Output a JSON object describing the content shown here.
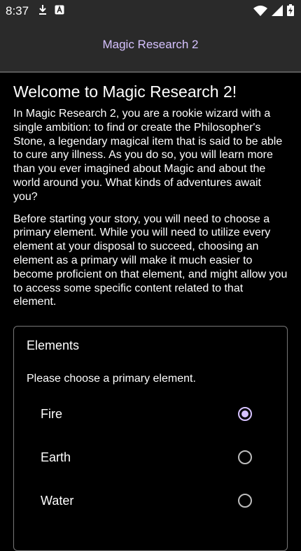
{
  "status_bar": {
    "time": "8:37",
    "left_icons": [
      "download-icon",
      "a-box-icon"
    ],
    "right_icons": [
      "wifi-icon",
      "signal-icon",
      "battery-charging-icon"
    ]
  },
  "app_bar": {
    "title": "Magic Research 2"
  },
  "intro": {
    "heading": "Welcome to Magic Research 2!",
    "paragraph_1": "In Magic Research 2, you are a rookie wizard with a single ambition: to find or create the Philosopher's Stone, a legendary magical item that is said to be able to cure any illness. As you do so, you will learn more than you ever imagined about Magic and about the world around you. What kinds of adventures await you?",
    "paragraph_2": "Before starting your story, you will need to choose a primary element. While you will need to utilize every element at your disposal to succeed, choosing an element as a primary will make it much easier to become proficient on that element, and might allow you to access some specific content related to that element."
  },
  "elements_card": {
    "title": "Elements",
    "subtitle": "Please choose a primary element.",
    "options": [
      {
        "label": "Fire",
        "selected": true
      },
      {
        "label": "Earth",
        "selected": false
      },
      {
        "label": "Water",
        "selected": false
      }
    ]
  },
  "colors": {
    "accent": "#d6c2ff",
    "app_bar_bg": "#2a2a2a",
    "background": "#000000"
  }
}
